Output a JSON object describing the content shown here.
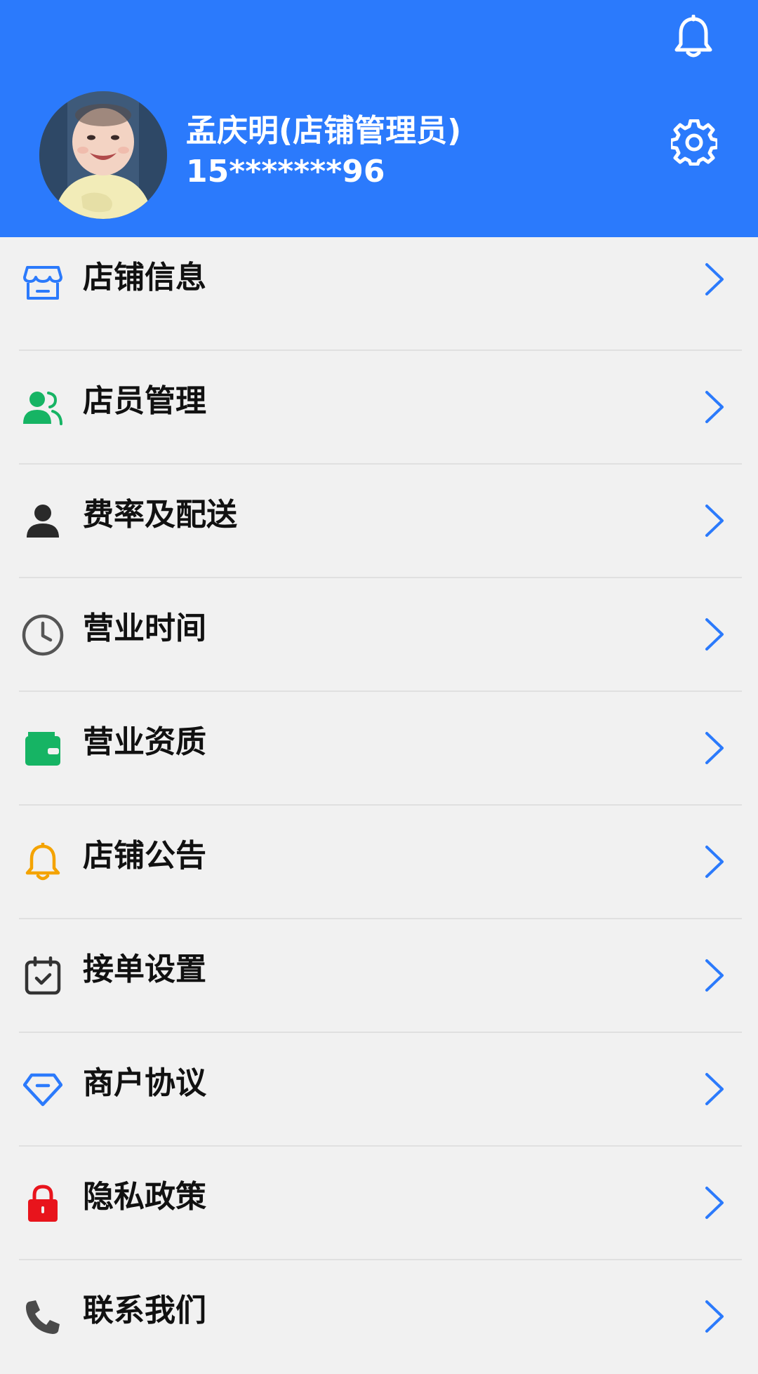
{
  "header": {
    "name": "孟庆明(店铺管理员)",
    "phone": "15*******96"
  },
  "menu": {
    "items": [
      {
        "label": "店铺信息",
        "icon": "store-icon",
        "color": "#2b7afc"
      },
      {
        "label": "店员管理",
        "icon": "staff-icon",
        "color": "#16b464"
      },
      {
        "label": "费率及配送",
        "icon": "person-icon",
        "color": "#2a2a2a"
      },
      {
        "label": "营业时间",
        "icon": "clock-icon",
        "color": "#555555"
      },
      {
        "label": "营业资质",
        "icon": "wallet-icon",
        "color": "#16b464"
      },
      {
        "label": "店铺公告",
        "icon": "bell-icon",
        "color": "#f4a300"
      },
      {
        "label": "接单设置",
        "icon": "calendar-check-icon",
        "color": "#333333"
      },
      {
        "label": "商户协议",
        "icon": "diamond-icon",
        "color": "#2b7afc"
      },
      {
        "label": "隐私政策",
        "icon": "lock-icon",
        "color": "#e8141c"
      },
      {
        "label": "联系我们",
        "icon": "phone-icon",
        "color": "#4a4a4a"
      }
    ]
  },
  "colors": {
    "primary": "#2b7afc",
    "background": "#f1f1f1",
    "chevron": "#2b7afc"
  }
}
